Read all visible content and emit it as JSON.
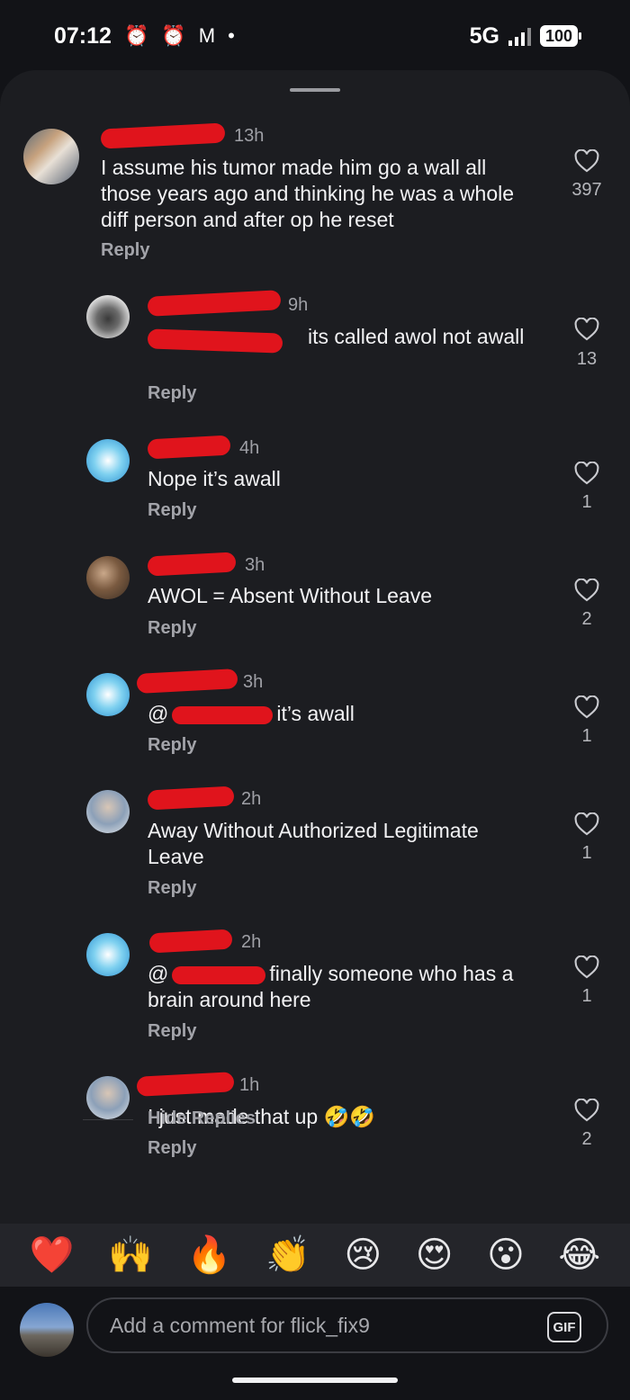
{
  "status_bar": {
    "time": "07:12",
    "icons": [
      "alarm-icon",
      "alarm-icon",
      "gmail-icon",
      "dot-icon"
    ],
    "network": "5G",
    "battery": "100"
  },
  "comments": [
    {
      "time": "13h",
      "text": "I assume his tumor made him go a wall all those years ago and thinking he was a whole diff person and after op he reset",
      "reply": "Reply",
      "likes": "397"
    },
    {
      "time": "9h",
      "text": "its called awol not awall",
      "reply": "Reply",
      "likes": "13"
    },
    {
      "time": "4h",
      "text": "Nope it’s awall",
      "reply": "Reply",
      "likes": "1"
    },
    {
      "time": "3h",
      "text": "AWOL = Absent Without Leave",
      "reply": "Reply",
      "likes": "2"
    },
    {
      "time": "3h",
      "text": "it’s awall",
      "reply": "Reply",
      "likes": "1"
    },
    {
      "time": "2h",
      "text": "Away Without Authorized Legitimate Leave",
      "reply": "Reply",
      "likes": "1"
    },
    {
      "time": "2h",
      "text": "finally someone who has a brain around here",
      "reply": "Reply",
      "likes": "1"
    },
    {
      "time": "1h",
      "text": "I just made that up 🤣🤣",
      "reply": "Reply",
      "likes": "2"
    }
  ],
  "hide_replies": "Hide Replies",
  "reactions": [
    "❤️",
    "🙌",
    "🔥",
    "👏",
    "😢",
    "😍",
    "😮",
    "😂"
  ],
  "composer": {
    "placeholder": "Add a comment for flick_fix9",
    "gif_label": "GIF"
  },
  "colors": {
    "background": "#121317",
    "sheet": "#1c1d21",
    "redaction": "#e0141c"
  }
}
